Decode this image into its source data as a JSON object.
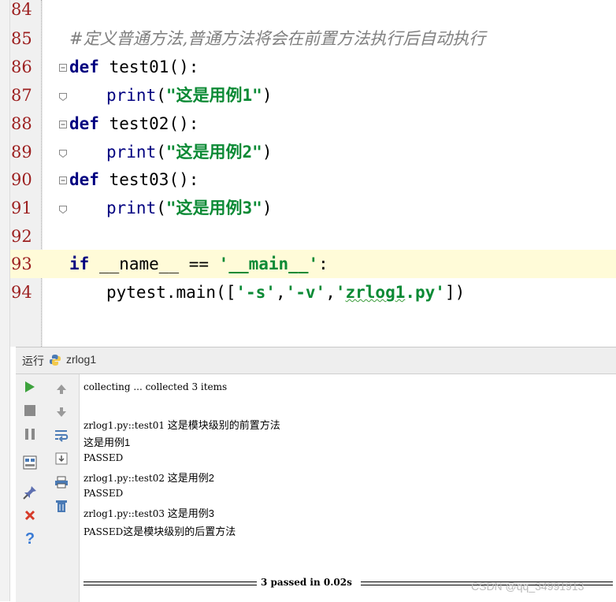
{
  "editor": {
    "lines": [
      {
        "num": "84"
      },
      {
        "num": "85",
        "comment": "#定义普通方法,普通方法将会在前置方法执行后自动执行"
      },
      {
        "num": "86",
        "kw": "def",
        "rest": " test01():"
      },
      {
        "num": "87",
        "builtin": "print",
        "open": "(",
        "str": "\"这是用例1\"",
        "close": ")"
      },
      {
        "num": "88",
        "kw": "def",
        "rest": " test02():"
      },
      {
        "num": "89",
        "builtin": "print",
        "open": "(",
        "str": "\"这是用例2\"",
        "close": ")"
      },
      {
        "num": "90",
        "kw": "def",
        "rest": " test03():"
      },
      {
        "num": "91",
        "builtin": "print",
        "open": "(",
        "str": "\"这是用例3\"",
        "close": ")"
      },
      {
        "num": "92"
      },
      {
        "num": "93",
        "kw": "if",
        "rest": " __name__ == ",
        "str": "'__main__'",
        "close": ":"
      },
      {
        "num": "94",
        "pre": "pytest.main([",
        "s1": "'-s'",
        "c1": ",",
        "s2": "'-v'",
        "c2": ",",
        "s3a": "'",
        "s3b": "zrlog1",
        "s3c": ".py'",
        "post": "])"
      }
    ]
  },
  "run_panel": {
    "label": "运行",
    "config": "zrlog1",
    "toolbar": {
      "run": "run-icon",
      "stop": "stop-icon",
      "pause": "pause-icon",
      "layout": "layout-icon",
      "pin": "pin-icon",
      "close": "close-icon",
      "help": "help-icon",
      "up": "arrow-up-icon",
      "down": "arrow-down-icon",
      "wrap": "soft-wrap-icon",
      "scroll": "scroll-to-end-icon",
      "print": "print-icon",
      "trash": "trash-icon"
    },
    "console": {
      "l1": "collecting ... collected 3 items",
      "l2a": "zrlog1.py::test01 ",
      "l2b": "这是模块级别的前置方法",
      "l3": "这是用例1",
      "l4": "PASSED",
      "l5a": "zrlog1.py::test02 ",
      "l5b": "这是用例2",
      "l6": "PASSED",
      "l7a": "zrlog1.py::test03 ",
      "l7b": "这是用例3",
      "l8a": "PASSED",
      "l8b": "这是模块级别的后置方法",
      "summary": "3 passed in 0.02s"
    }
  },
  "watermark": "CSDN @qq_34991913",
  "colors": {
    "keyword": "#000080",
    "string": "#0b8a35",
    "line_number": "#9c1f1f",
    "highlight": "#fffbd8"
  }
}
